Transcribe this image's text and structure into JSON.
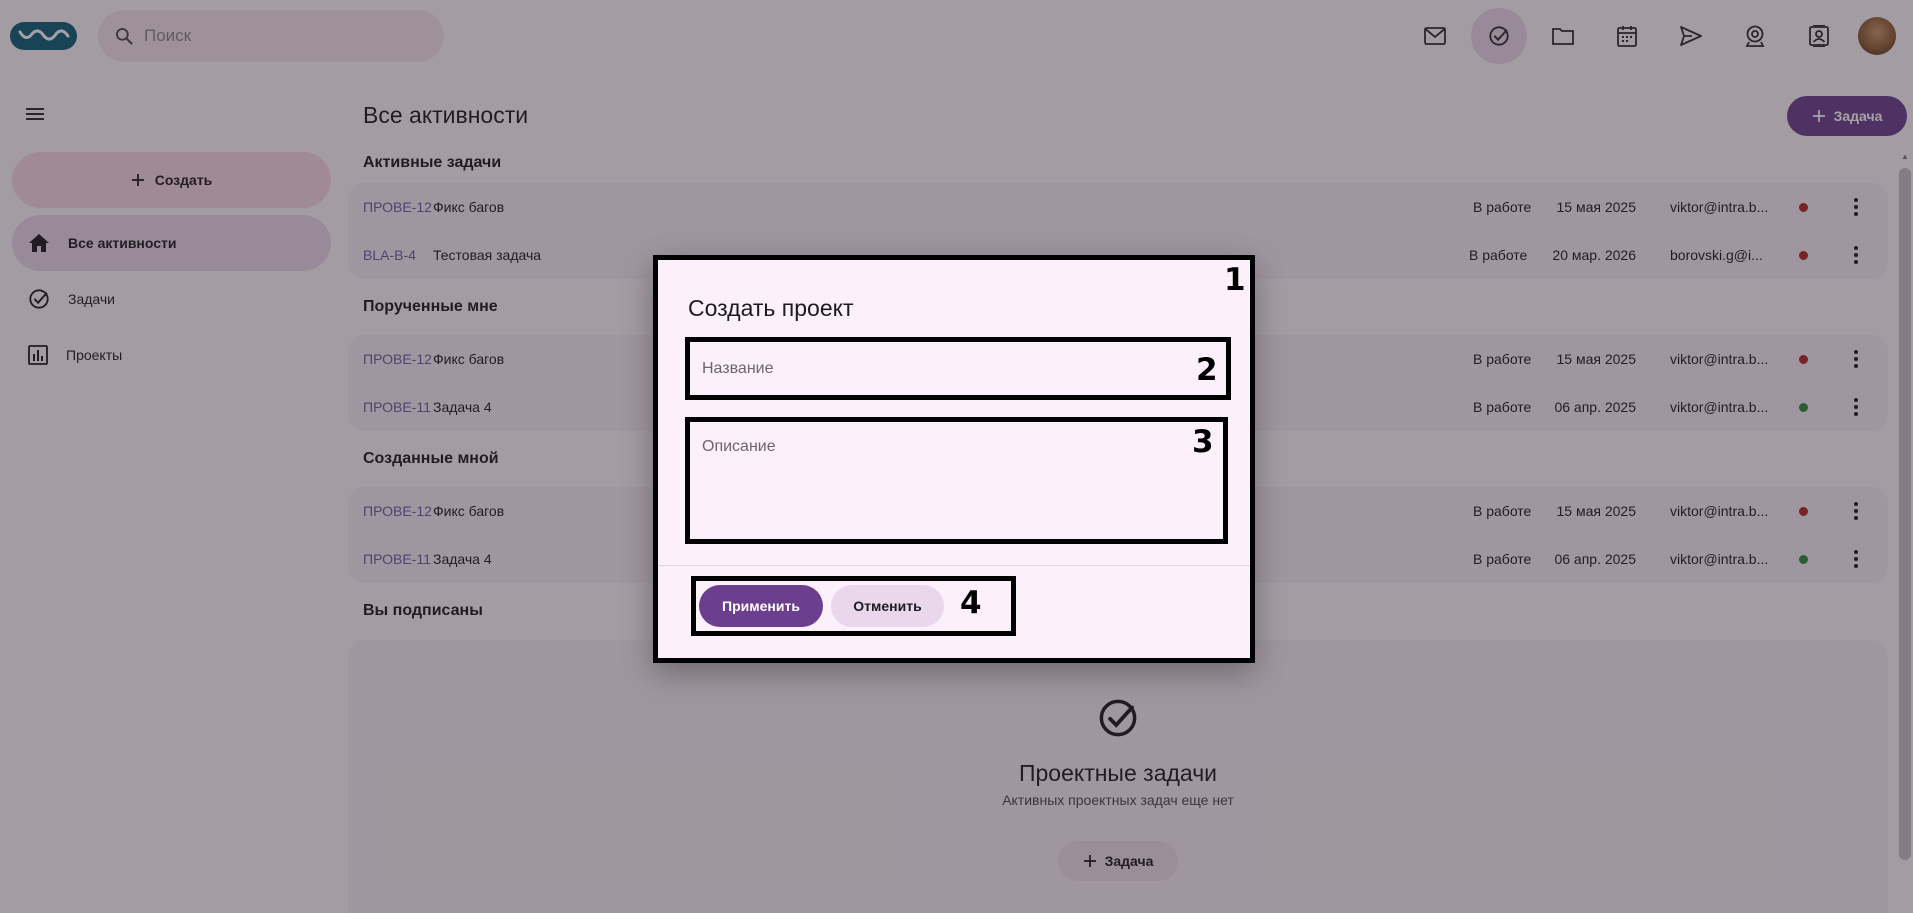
{
  "header": {
    "search": {
      "placeholder": "Поиск"
    },
    "icons": [
      "logo-icon",
      "search-icon",
      "mail-icon",
      "tasks-icon",
      "folder-icon",
      "calendar-icon",
      "send-icon",
      "video-call-icon",
      "contacts-icon",
      "avatar"
    ]
  },
  "sidebar": {
    "create_label": "Создать",
    "items": [
      {
        "label": "Все активности",
        "icon": "home-icon",
        "active": true
      },
      {
        "label": "Задачи",
        "icon": "check-circle-icon",
        "active": false
      },
      {
        "label": "Проекты",
        "icon": "bar-chart-icon",
        "active": false
      }
    ]
  },
  "main": {
    "title": "Все активности",
    "add_task_label": "Задача",
    "sections": [
      {
        "title": "Активные задачи",
        "rows": [
          {
            "key": "ПРОВЕ-12",
            "name": "Фикс багов",
            "status": "В работе",
            "date": "15 мая 2025",
            "user": "viktor@intra.b...",
            "dot": "#b3261e"
          },
          {
            "key": "BLA-B-4",
            "name": "Тестовая задача",
            "status": "В работе",
            "date": "20 мар. 2026",
            "user": "borovski.g@i...",
            "dot": "#b3261e"
          }
        ]
      },
      {
        "title": "Порученные мне",
        "rows": [
          {
            "key": "ПРОВЕ-12",
            "name": "Фикс багов",
            "status": "В работе",
            "date": "15 мая 2025",
            "user": "viktor@intra.b...",
            "dot": "#b3261e"
          },
          {
            "key": "ПРОВЕ-11",
            "name": "Задача 4",
            "status": "В работе",
            "date": "06 апр. 2025",
            "user": "viktor@intra.b...",
            "dot": "#2e8b3a"
          }
        ]
      },
      {
        "title": "Созданные мной",
        "rows": [
          {
            "key": "ПРОВЕ-12",
            "name": "Фикс багов",
            "status": "В работе",
            "date": "15 мая 2025",
            "user": "viktor@intra.b...",
            "dot": "#b3261e"
          },
          {
            "key": "ПРОВЕ-11",
            "name": "Задача 4",
            "status": "В работе",
            "date": "06 апр. 2025",
            "user": "viktor@intra.b...",
            "dot": "#2e8b3a"
          }
        ]
      }
    ],
    "subscribed": {
      "title": "Вы подписаны",
      "empty_title": "Проектные задачи",
      "empty_subtitle": "Активных проектных задач еще нет",
      "add_label": "Задача"
    }
  },
  "dialog": {
    "title": "Создать проект",
    "name_placeholder": "Название",
    "description_placeholder": "Описание",
    "apply_label": "Применить",
    "cancel_label": "Отменить",
    "markers": [
      "1",
      "2",
      "3",
      "4"
    ]
  },
  "colors": {
    "accent": "#6b3f8e",
    "status_red": "#b3261e",
    "status_green": "#2e8b3a"
  }
}
